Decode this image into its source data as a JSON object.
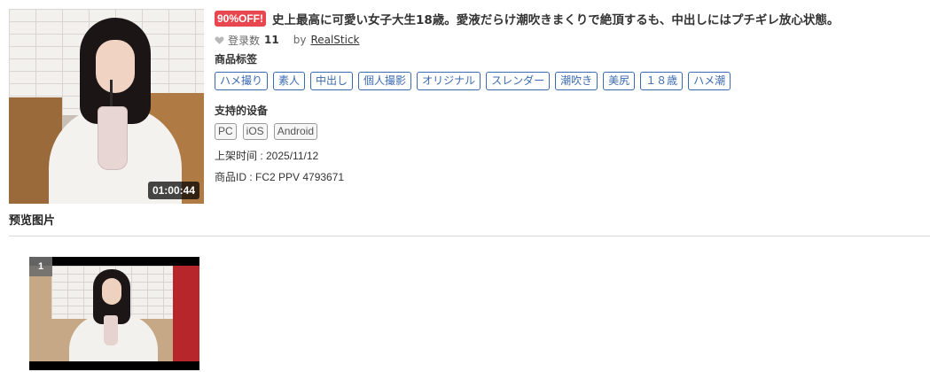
{
  "product": {
    "duration": "01:00:44",
    "discount_badge": "90%OFF!",
    "title": "史上最高に可愛い女子大生18歳。愛液だらけ潮吹きまくりで絶頂するも、中出しにはプチギレ放心状態。",
    "favorite_label": "登录数",
    "favorite_count": "11",
    "by_label": "by",
    "seller": "RealStick",
    "tags_label": "商品标签",
    "tags": [
      "ハメ撮り",
      "素人",
      "中出し",
      "個人撮影",
      "オリジナル",
      "スレンダー",
      "潮吹き",
      "美尻",
      "１８歳",
      "ハメ潮"
    ],
    "devices_label": "支持的设备",
    "devices": [
      "PC",
      "iOS",
      "Android"
    ],
    "release_date": "上架时间 : 2025/11/12",
    "product_id": "商品ID : FC2 PPV 4793671",
    "icons": {
      "favorite": "heart-icon"
    },
    "colors": {
      "discount": "#e8474f",
      "tag": "#3b6bb0"
    }
  },
  "preview": {
    "heading": "预览图片",
    "images": [
      {
        "number": "1"
      }
    ]
  }
}
